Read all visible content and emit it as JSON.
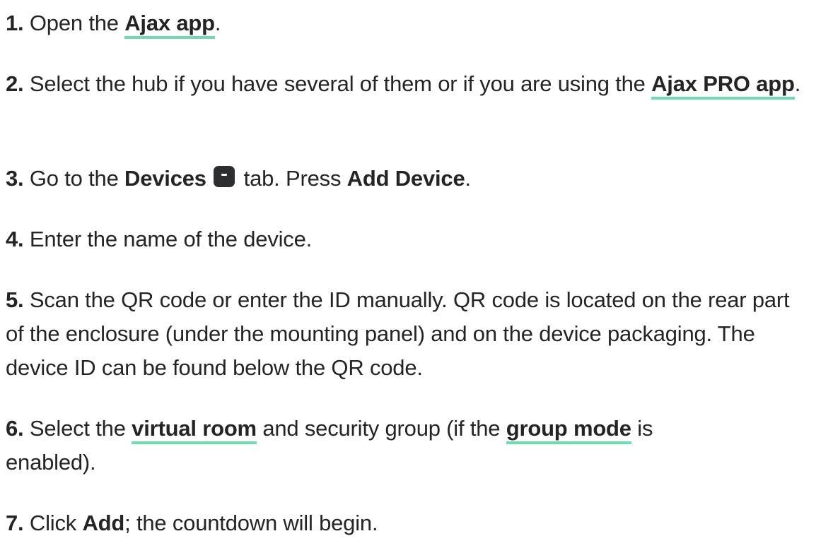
{
  "steps": [
    {
      "num": "1.",
      "pre": "Open the ",
      "link": "Ajax app",
      "post": "."
    },
    {
      "num": "2.",
      "pre": "Select the hub if you have several of them or if you are using the ",
      "link": "Ajax PRO app",
      "post": "."
    },
    {
      "num": "3.",
      "pre": "Go to the ",
      "bold1": "Devices",
      "icon": "devices-tab-icon",
      "mid": " tab. Press ",
      "bold2": "Add Device",
      "post": "."
    },
    {
      "num": "4.",
      "text": "Enter the name of the device."
    },
    {
      "num": "5.",
      "text": "Scan the QR code or enter the ID manually. QR code is located on the rear part of the enclosure (under the mounting panel) and on the device packaging. The device ID can be found below the QR code."
    },
    {
      "num": "6.",
      "pre": "Select the ",
      "link1": "virtual room",
      "mid": " and security group (if the ",
      "link2": "group mode",
      "post": " is enabled)."
    },
    {
      "num": "7.",
      "pre": "Click ",
      "bold": "Add",
      "post": "; the countdown will begin."
    }
  ],
  "colors": {
    "text": "#222426",
    "link_underline": "#6fdbb0",
    "icon_bg": "#2c2e30"
  }
}
